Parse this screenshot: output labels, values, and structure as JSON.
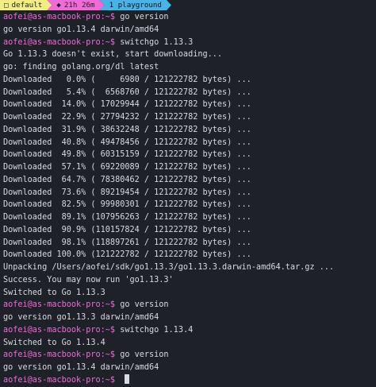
{
  "tabs": [
    {
      "icon": "□",
      "label": "default"
    },
    {
      "icon": "◆",
      "label": "21h 26m"
    },
    {
      "icon": "",
      "label": "1 playground"
    }
  ],
  "prompt": "aofei@as-macbook-pro:~$",
  "lines": [
    {
      "type": "cmd",
      "text": "go version"
    },
    {
      "type": "out",
      "text": "go version go1.13.4 darwin/amd64"
    },
    {
      "type": "cmd",
      "text": "switchgo 1.13.3"
    },
    {
      "type": "out",
      "text": "Go 1.13.3 doesn't exist, start downloading..."
    },
    {
      "type": "out",
      "text": "go: finding golang.org/dl latest"
    },
    {
      "type": "out",
      "text": "Downloaded   0.0% (     6980 / 121222782 bytes) ..."
    },
    {
      "type": "out",
      "text": "Downloaded   5.4% (  6568760 / 121222782 bytes) ..."
    },
    {
      "type": "out",
      "text": "Downloaded  14.0% ( 17029944 / 121222782 bytes) ..."
    },
    {
      "type": "out",
      "text": "Downloaded  22.9% ( 27794232 / 121222782 bytes) ..."
    },
    {
      "type": "out",
      "text": "Downloaded  31.9% ( 38632248 / 121222782 bytes) ..."
    },
    {
      "type": "out",
      "text": "Downloaded  40.8% ( 49478456 / 121222782 bytes) ..."
    },
    {
      "type": "out",
      "text": "Downloaded  49.8% ( 60315159 / 121222782 bytes) ..."
    },
    {
      "type": "out",
      "text": "Downloaded  57.1% ( 69220089 / 121222782 bytes) ..."
    },
    {
      "type": "out",
      "text": "Downloaded  64.7% ( 78380462 / 121222782 bytes) ..."
    },
    {
      "type": "out",
      "text": "Downloaded  73.6% ( 89219454 / 121222782 bytes) ..."
    },
    {
      "type": "out",
      "text": "Downloaded  82.5% ( 99980301 / 121222782 bytes) ..."
    },
    {
      "type": "out",
      "text": "Downloaded  89.1% (107956263 / 121222782 bytes) ..."
    },
    {
      "type": "out",
      "text": "Downloaded  90.9% (110157824 / 121222782 bytes) ..."
    },
    {
      "type": "out",
      "text": "Downloaded  98.1% (118897261 / 121222782 bytes) ..."
    },
    {
      "type": "out",
      "text": "Downloaded 100.0% (121222782 / 121222782 bytes) ..."
    },
    {
      "type": "out",
      "text": "Unpacking /Users/aofei/sdk/go1.13.3/go1.13.3.darwin-amd64.tar.gz ..."
    },
    {
      "type": "out",
      "text": "Success. You may now run 'go1.13.3'"
    },
    {
      "type": "out",
      "text": "Switched to Go 1.13.3"
    },
    {
      "type": "cmd",
      "text": "go version"
    },
    {
      "type": "out",
      "text": "go version go1.13.3 darwin/amd64"
    },
    {
      "type": "cmd",
      "text": "switchgo 1.13.4"
    },
    {
      "type": "out",
      "text": "Switched to Go 1.13.4"
    },
    {
      "type": "cmd",
      "text": "go version"
    },
    {
      "type": "out",
      "text": "go version go1.13.4 darwin/amd64"
    },
    {
      "type": "cmd",
      "text": ""
    }
  ],
  "colors": {
    "background": "#1e2127",
    "prompt": "#f06bd6",
    "text": "#d7dae0",
    "tab_default": "#f2ec83",
    "tab_time": "#f06bd6",
    "tab_window": "#49b3e7"
  }
}
